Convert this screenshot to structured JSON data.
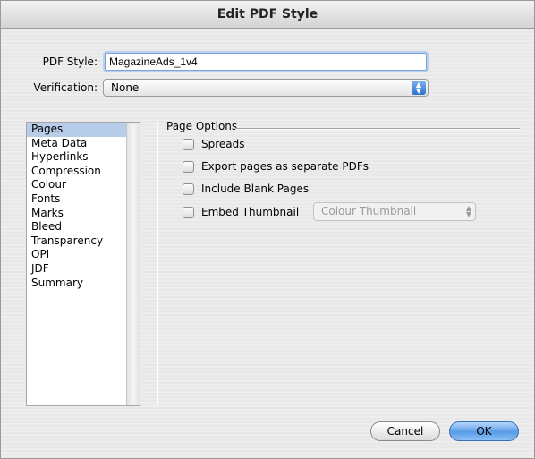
{
  "window": {
    "title": "Edit PDF Style"
  },
  "form": {
    "pdf_style_label": "PDF Style:",
    "pdf_style_value": "MagazineAds_1v4",
    "verification_label": "Verification:",
    "verification_value": "None"
  },
  "sidebar": {
    "items": [
      {
        "label": "Pages",
        "selected": true
      },
      {
        "label": "Meta Data"
      },
      {
        "label": "Hyperlinks"
      },
      {
        "label": "Compression"
      },
      {
        "label": "Colour"
      },
      {
        "label": "Fonts"
      },
      {
        "label": "Marks"
      },
      {
        "label": "Bleed"
      },
      {
        "label": "Transparency"
      },
      {
        "label": "OPI"
      },
      {
        "label": "JDF"
      },
      {
        "label": "Summary"
      }
    ]
  },
  "page_options": {
    "title": "Page Options",
    "spreads_label": "Spreads",
    "export_separate_label": "Export pages as separate PDFs",
    "include_blank_label": "Include Blank Pages",
    "embed_thumbnail_label": "Embed Thumbnail",
    "thumbnail_select_value": "Colour Thumbnail"
  },
  "buttons": {
    "cancel_label": "Cancel",
    "ok_label": "OK"
  },
  "colors": {
    "accent": "#5a9ce8",
    "selection": "#b8cde9"
  }
}
